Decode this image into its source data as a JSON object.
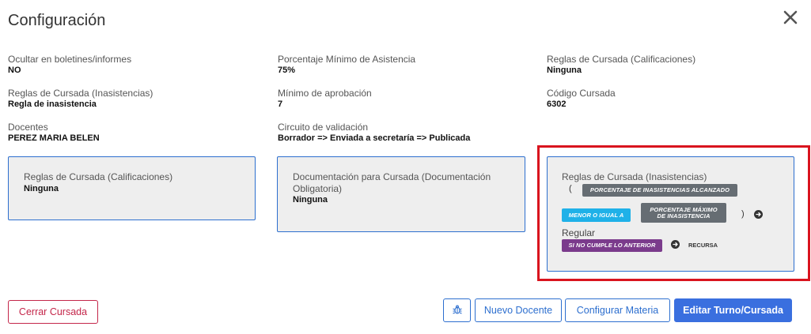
{
  "modal": {
    "title": "Configuración",
    "close_icon": "close-icon"
  },
  "fields": [
    {
      "label": "Ocultar en boletines/informes",
      "value": "NO"
    },
    {
      "label": "Porcentaje Mínimo de Asistencia",
      "value": "75%"
    },
    {
      "label": "Reglas de Cursada (Calificaciones)",
      "value": "Ninguna"
    },
    {
      "label": "Reglas de Cursada (Inasistencias)",
      "value": "Regla de inasistencia"
    },
    {
      "label": "Mínimo de aprobación",
      "value": "7"
    },
    {
      "label": "Código Cursada",
      "value": "6302"
    },
    {
      "label": "Docentes",
      "value": "PEREZ MARIA BELEN"
    },
    {
      "label": "Circuito de validación",
      "value": "Borrador => Enviada a secretaría => Publicada"
    }
  ],
  "cards": {
    "calificaciones": {
      "label": "Reglas de Cursada (Calificaciones)",
      "value": "Ninguna"
    },
    "documentacion": {
      "label": "Documentación para Cursada (Documentación Obligatoria)",
      "value": "Ninguna"
    },
    "inasistencias": {
      "label": "Reglas de Cursada (Inasistencias)",
      "open_paren": "(",
      "close_paren": ")",
      "tag_condition": "PORCENTAJE DE INASISTENCIAS ALCANZADO",
      "tag_operator": "MENOR O IGUAL A",
      "tag_threshold": "PORCENTAJE MÁXIMO DE INASISTENCIA",
      "result_label": "Regular",
      "tag_else": "SI NO CUMPLE LO ANTERIOR",
      "else_result": "RECURSA",
      "colors": {
        "gray": "#666d73",
        "cyan": "#1fb1e8",
        "purple": "#7b3b8c"
      }
    }
  },
  "footer": {
    "close_course": "Cerrar Cursada",
    "bug_icon": "bug-icon",
    "new_teacher": "Nuevo Docente",
    "configure_subject": "Configurar Materia",
    "edit_shift": "Editar Turno/Cursada"
  },
  "colors": {
    "accent": "#3a6fdf",
    "danger": "#c4264a",
    "highlight": "#d9141e"
  }
}
